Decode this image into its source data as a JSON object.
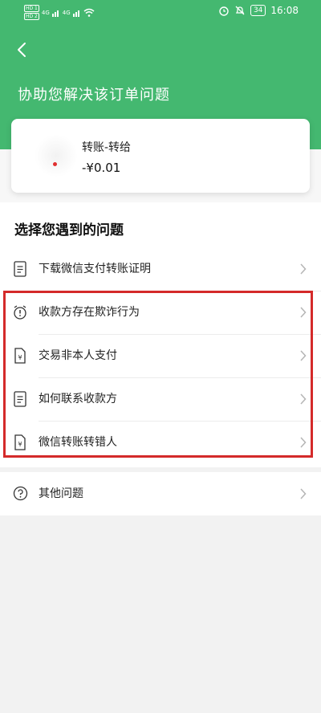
{
  "status_bar": {
    "hd1": "HD 1",
    "hd2": "HD 2",
    "signal1": "4G",
    "signal2": "4G",
    "battery": "34",
    "time": "16:08"
  },
  "header": {
    "title": "协助您解决该订单问题"
  },
  "order_card": {
    "name": "转账-转给",
    "amount": "-¥0.01"
  },
  "section": {
    "title": "选择您遇到的问题"
  },
  "problems": [
    {
      "label": "下载微信支付转账证明",
      "icon": "receipt-icon"
    },
    {
      "label": "收款方存在欺诈行为",
      "icon": "alarm-icon"
    },
    {
      "label": "交易非本人支付",
      "icon": "yen-document-icon"
    },
    {
      "label": "如何联系收款方",
      "icon": "receipt-icon"
    },
    {
      "label": "微信转账转错人",
      "icon": "yen-document-icon"
    }
  ],
  "other": {
    "label": "其他问题",
    "icon": "question-circle-icon"
  },
  "colors": {
    "header_green": "#44b870",
    "highlight_red": "#d42a2a"
  }
}
